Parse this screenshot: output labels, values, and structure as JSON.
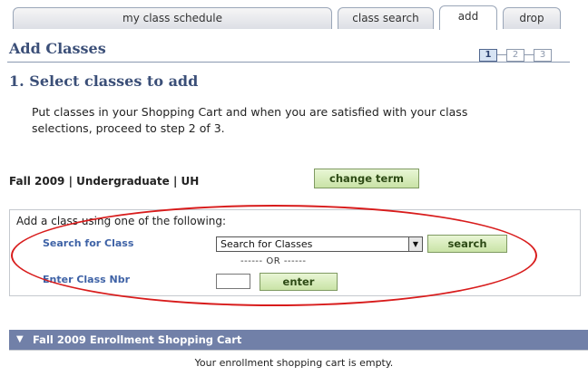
{
  "tabs": [
    {
      "label": "my class schedule",
      "active": false
    },
    {
      "label": "class search",
      "active": false
    },
    {
      "label": "add",
      "active": true
    },
    {
      "label": "drop",
      "active": false
    }
  ],
  "page": {
    "title": "Add Classes",
    "heading": "1.  Select classes to add",
    "instructions": "Put classes in your Shopping Cart and when you are satisfied with your class selections, proceed to step 2 of 3."
  },
  "steps": [
    "1",
    "2",
    "3"
  ],
  "current_step": 1,
  "term": {
    "label": "Fall 2009 | Undergraduate | UH",
    "change_button": "change term"
  },
  "add_panel": {
    "title": "Add a class using one of the following:",
    "search_label": "Search for Class",
    "search_select_value": "Search for Classes",
    "search_button": "search",
    "or_text": "------ OR ------",
    "enter_label": "Enter Class Nbr",
    "class_nbr_value": "",
    "enter_button": "enter"
  },
  "cart": {
    "title": "Fall 2009 Enrollment Shopping Cart",
    "empty_message": "Your enrollment shopping cart is empty."
  },
  "colors": {
    "accent_blue": "#3b4f78",
    "button_green": "#c9e3a6",
    "cart_bar": "#7180a8",
    "highlight_oval": "#d81c1c"
  }
}
